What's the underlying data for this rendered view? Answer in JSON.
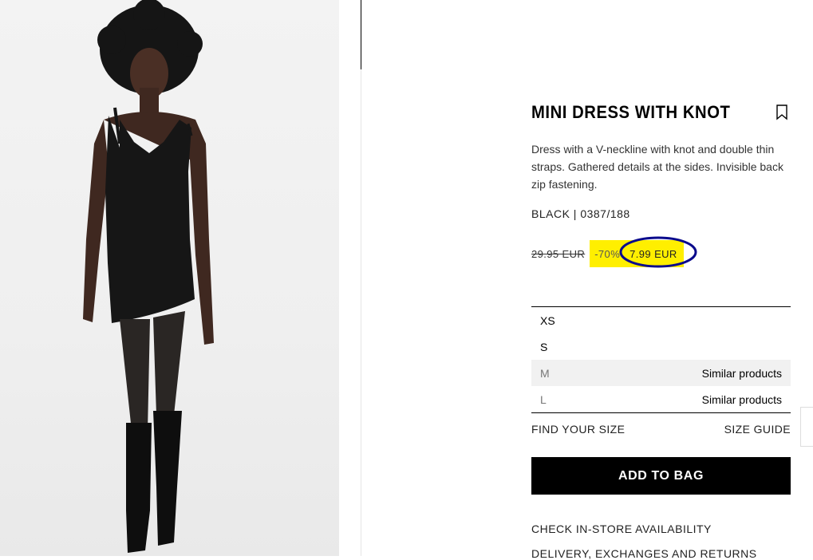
{
  "product": {
    "image_alt": "Model wearing black mini dress and knee-high boots",
    "title": "MINI DRESS WITH KNOT",
    "description": "Dress with a V-neckline with knot and double thin straps. Gathered details at the sides. Invisible back zip fastening.",
    "color_ref": "BLACK | 0387/188",
    "old_price": "29.95 EUR",
    "discount": "-70%",
    "new_price": "7.99 EUR"
  },
  "sizes": [
    {
      "label": "XS",
      "available": true,
      "note": ""
    },
    {
      "label": "S",
      "available": true,
      "note": ""
    },
    {
      "label": "M",
      "available": false,
      "note": "Similar products"
    },
    {
      "label": "L",
      "available": false,
      "note": "Similar products"
    }
  ],
  "links": {
    "find_size": "FIND YOUR SIZE",
    "size_guide": "SIZE GUIDE",
    "store_availability": "CHECK IN-STORE AVAILABILITY",
    "delivery": "DELIVERY, EXCHANGES AND RETURNS"
  },
  "actions": {
    "add_to_bag": "ADD TO BAG"
  },
  "colors": {
    "highlight": "#ffef00",
    "annotation_circle": "#0a0a8c",
    "button": "#000000"
  }
}
